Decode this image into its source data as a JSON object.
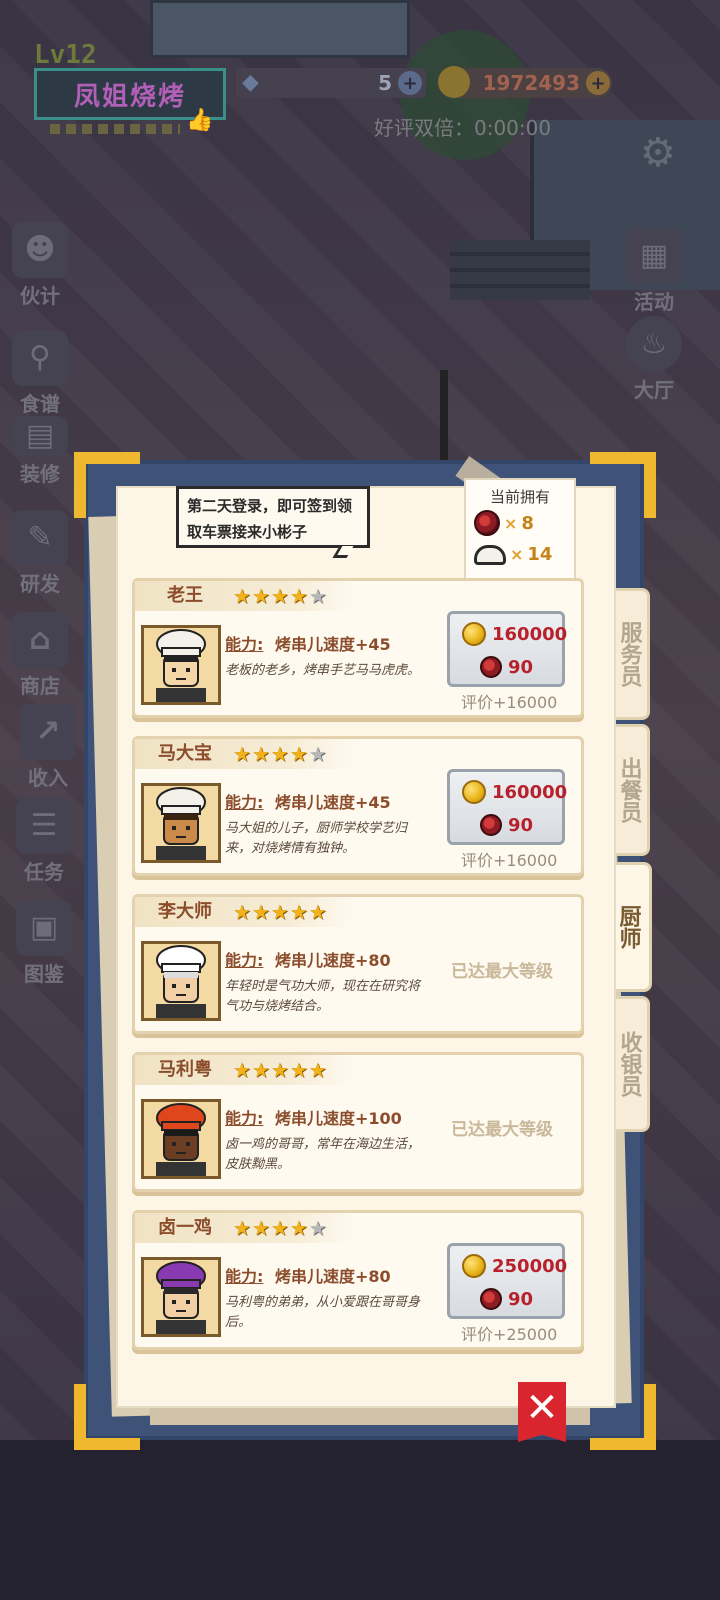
{
  "hud": {
    "level": "Lv12",
    "restaurant_name": "凤姐烧烤",
    "gems": "5",
    "gold": "1972493",
    "double_rating": "好评双倍：0:00:00",
    "plus": "+"
  },
  "left_menu": [
    {
      "label": "伙计",
      "icon": "chef-hat-icon"
    },
    {
      "label": "食谱",
      "icon": "skewer-icon"
    },
    {
      "label": "装修",
      "icon": "decorate-icon"
    },
    {
      "label": "研发",
      "icon": "research-icon"
    },
    {
      "label": "商店",
      "icon": "shop-icon"
    },
    {
      "label": "收入",
      "icon": "income-icon"
    },
    {
      "label": "任务",
      "icon": "task-icon"
    },
    {
      "label": "图鉴",
      "icon": "book-icon"
    }
  ],
  "right_menu": [
    {
      "label": "活动",
      "icon": "calendar-icon"
    },
    {
      "label": "大厅",
      "icon": "hall-icon"
    }
  ],
  "panel": {
    "tip": "第二天登录，即可签到领取车票接来小彬子",
    "owned": {
      "title": "当前拥有",
      "tickets": "8",
      "caps": "14",
      "times": "×"
    },
    "ability_label": "能力:",
    "staff": [
      {
        "name": "老王",
        "stars": 4,
        "ability": "烤串儿速度+45",
        "desc": "老板的老乡，烤串手艺马马虎虎。",
        "price_coins": "160000",
        "price_tickets": "90",
        "rating": "评价+16000",
        "maxed": false,
        "hat": "#f4f1ea",
        "skin": "#f5d6a8",
        "hair": "#222"
      },
      {
        "name": "马大宝",
        "stars": 4,
        "ability": "烤串儿速度+45",
        "desc": "马大姐的儿子，厨师学校学艺归来，对烧烤情有独钟。",
        "price_coins": "160000",
        "price_tickets": "90",
        "rating": "评价+16000",
        "maxed": false,
        "hat": "#f4f1ea",
        "skin": "#c98a4a",
        "hair": "#3a2410"
      },
      {
        "name": "李大师",
        "stars": 5,
        "ability": "烤串儿速度+80",
        "desc": "年轻时是气功大师，现在在研究将气功与烧烤结合。",
        "maxed": true,
        "maxed_text": "已达最大等级",
        "hat": "#ffffff",
        "skin": "#f3cfa6",
        "hair": "#ddd"
      },
      {
        "name": "马利粤",
        "stars": 5,
        "ability": "烤串儿速度+100",
        "desc": "卤一鸡的哥哥，常年在海边生活，皮肤黝黑。",
        "maxed": true,
        "maxed_text": "已达最大等级",
        "hat": "#e0461c",
        "skin": "#6b3e24",
        "hair": "#1a1a1a"
      },
      {
        "name": "卤一鸡",
        "stars": 4,
        "ability": "烤串儿速度+80",
        "desc": "马利粤的弟弟，从小爱跟在哥哥身后。",
        "price_coins": "250000",
        "price_tickets": "90",
        "rating": "评价+25000",
        "maxed": false,
        "hat": "#8a3ab0",
        "skin": "#f3cfa6",
        "hair": "#2a2a2a"
      }
    ],
    "tabs": [
      {
        "label": "服务员",
        "active": false
      },
      {
        "label": "出餐员",
        "active": false
      },
      {
        "label": "厨师",
        "active": true
      },
      {
        "label": "收银员",
        "active": false
      }
    ],
    "close": "✕"
  },
  "colors": {
    "gold_corner": "#f0b82e",
    "price_red": "#b8202c",
    "name_brown": "#8b4d2b",
    "panel_blue": "#3f5378"
  }
}
